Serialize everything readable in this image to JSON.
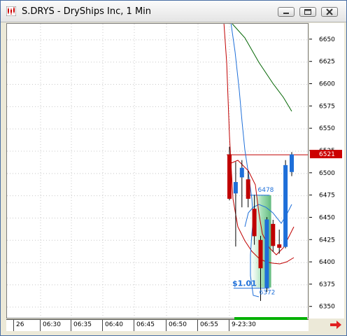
{
  "window": {
    "title": "S.DRYS - DryShips Inc, 1 Min",
    "controls": [
      "minimize",
      "maximize",
      "close"
    ]
  },
  "chart_data": {
    "type": "candlestick",
    "y_ticks": [
      6650,
      6625,
      6600,
      6575,
      6550,
      6525,
      6500,
      6475,
      6450,
      6425,
      6400,
      6375,
      6350
    ],
    "y_label_texts": [
      "6650",
      "6625",
      "6600",
      "6575",
      "6550",
      "6525",
      "6500",
      "6475",
      "6450",
      "6425",
      "6400",
      "6375",
      "6350"
    ],
    "ylim": [
      6338,
      6668
    ],
    "x_tick_labels": [
      "26",
      "06:30",
      "06:35",
      "06:40",
      "06:45",
      "06:50",
      "06:55",
      "9-23:30"
    ],
    "current_price_label": "6521",
    "current_price": 6521,
    "annotations": {
      "high_label": "6478",
      "low_label": "6372",
      "range_label": "$1.01"
    },
    "candles": [
      {
        "x": 1,
        "open": 6521,
        "close": 6472,
        "high": 6530,
        "low": 6470
      },
      {
        "x": 2,
        "open": 6478,
        "close": 6490,
        "high": 6513,
        "low": 6418
      },
      {
        "x": 3,
        "open": 6496,
        "close": 6506,
        "high": 6515,
        "low": 6462
      },
      {
        "x": 4,
        "open": 6493,
        "close": 6472,
        "high": 6503,
        "low": 6462
      },
      {
        "x": 5,
        "open": 6460,
        "close": 6430,
        "high": 6476,
        "low": 6420
      },
      {
        "x": 6,
        "open": 6425,
        "close": 6394,
        "high": 6430,
        "low": 6357
      },
      {
        "x": 7,
        "open": 6372,
        "close": 6448,
        "high": 6451,
        "low": 6367
      },
      {
        "x": 8,
        "open": 6443,
        "close": 6419,
        "high": 6448,
        "low": 6412
      },
      {
        "x": 9,
        "open": 6420,
        "close": 6417,
        "high": 6437,
        "low": 6410
      },
      {
        "x": 10,
        "open": 6418,
        "close": 6509,
        "high": 6515,
        "low": 6416
      },
      {
        "x": 11,
        "open": 6502,
        "close": 6521,
        "high": 6524,
        "low": 6497
      }
    ],
    "series": [
      {
        "color": "#c00000",
        "type": "line"
      },
      {
        "color": "#1e6fd9",
        "type": "line"
      },
      {
        "color": "#006400",
        "type": "line"
      }
    ],
    "colors": {
      "up": "#1e6fd9",
      "down": "#c00000",
      "price_tag_bg": "#cc0000",
      "session_bar": "#00b000"
    }
  }
}
